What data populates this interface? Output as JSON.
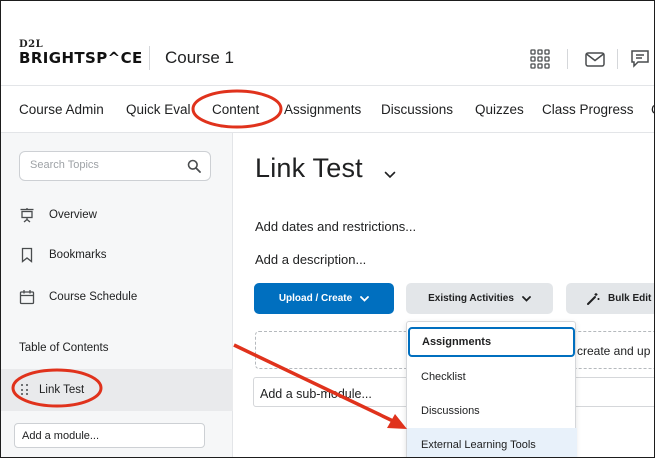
{
  "header": {
    "logo_top": "D2L",
    "logo_bottom": "BRIGHTSP^CE",
    "course_title": "Course 1"
  },
  "nav": {
    "items": [
      "Course Admin",
      "Quick Eval",
      "Content",
      "Assignments",
      "Discussions",
      "Quizzes",
      "Class Progress",
      "C"
    ]
  },
  "sidebar": {
    "search_placeholder": "Search Topics",
    "items": [
      "Overview",
      "Bookmarks",
      "Course Schedule"
    ],
    "toc_label": "Table of Contents",
    "toc_item": "Link Test",
    "add_module": "Add a module..."
  },
  "main": {
    "title": "Link Test",
    "add_dates": "Add dates and restrictions...",
    "add_description": "Add a description...",
    "upload_create": "Upload / Create",
    "existing_activities": "Existing Activities",
    "bulk_edit": "Bulk Edit",
    "zone_text": "create and up",
    "add_submodule": "Add a sub-module..."
  },
  "dropdown": {
    "items": [
      "Assignments",
      "Checklist",
      "Discussions",
      "External Learning Tools"
    ]
  },
  "colors": {
    "primary": "#006fbf",
    "annotation_red": "#e0321c"
  }
}
